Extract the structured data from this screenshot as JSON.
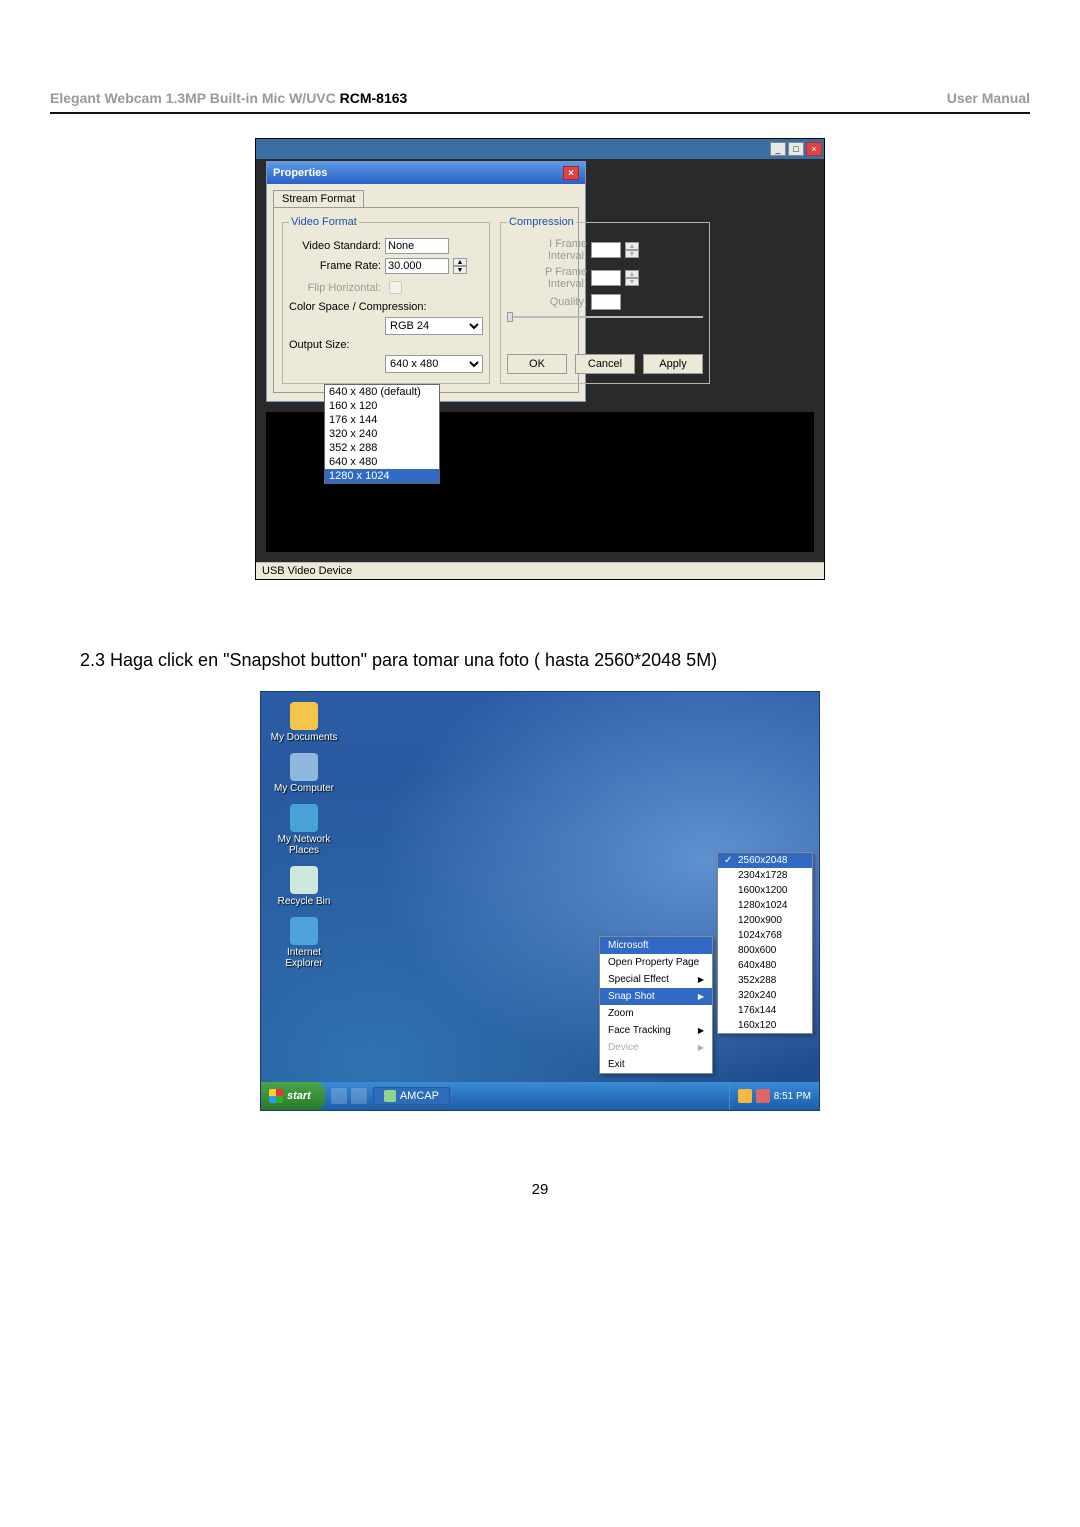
{
  "header": {
    "product": "Elegant  Webcam  1.3MP  Built-in  Mic  W/UVC ",
    "model": "RCM-8163",
    "right": "User  Manual"
  },
  "shot1": {
    "modalTitle": "Properties",
    "tab": "Stream Format",
    "groups": {
      "video": "Video Format",
      "compression": "Compression"
    },
    "videoStandard": {
      "label": "Video Standard:",
      "value": "None"
    },
    "frameRate": {
      "label": "Frame Rate:",
      "value": "30.000"
    },
    "flipH": {
      "label": "Flip Horizontal:"
    },
    "colorSpace": {
      "label": "Color Space / Compression:",
      "value": "RGB 24"
    },
    "outputSize": {
      "label": "Output Size:",
      "value": "640 x 480"
    },
    "dropdownOptions": [
      "640 x 480  (default)",
      "160 x 120",
      "176 x 144",
      "320 x 240",
      "352 x 288",
      "640 x 480",
      "1280 x 1024"
    ],
    "dropdownHighlightIndex": 6,
    "iFrame": {
      "label": "I Frame Interval:"
    },
    "pFrame": {
      "label": "P Frame Interval:"
    },
    "quality": {
      "label": "Quality:"
    },
    "buttons": {
      "ok": "OK",
      "cancel": "Cancel",
      "apply": "Apply"
    },
    "status": "USB Video Device"
  },
  "sectionText": "2.3 Haga click en \"Snapshot button\" para tomar una foto ( hasta 2560*2048 5M)",
  "shot2": {
    "desktop": [
      {
        "label": "My Documents",
        "color": "#f3c54a"
      },
      {
        "label": "My Computer",
        "color": "#8fb7de"
      },
      {
        "label": "My Network Places",
        "color": "#4aa3d6"
      },
      {
        "label": "Recycle Bin",
        "color": "#cfe6db"
      },
      {
        "label": "Internet Explorer",
        "color": "#4fa3dd"
      }
    ],
    "context": {
      "items": [
        {
          "label": "Microsoft",
          "hl": true,
          "arrow": false
        },
        {
          "label": "Open Property Page"
        },
        {
          "label": "Special Effect",
          "arrow": true
        },
        {
          "label": "Snap Shot",
          "hl": true,
          "arrow": true
        },
        {
          "label": "Zoom"
        },
        {
          "label": "Face Tracking",
          "arrow": true
        },
        {
          "label": "Device",
          "dis": true,
          "arrow": true
        },
        {
          "label": "Exit"
        }
      ]
    },
    "submenu": {
      "checkedIndex": 0,
      "items": [
        "2560x2048",
        "2304x1728",
        "1600x1200",
        "1280x1024",
        "1200x900",
        "1024x768",
        "800x600",
        "640x480",
        "352x288",
        "320x240",
        "176x144",
        "160x120"
      ]
    },
    "taskbar": {
      "start": "start",
      "app": "AMCAP",
      "clock": "8:51 PM"
    }
  },
  "pageNumber": "29"
}
